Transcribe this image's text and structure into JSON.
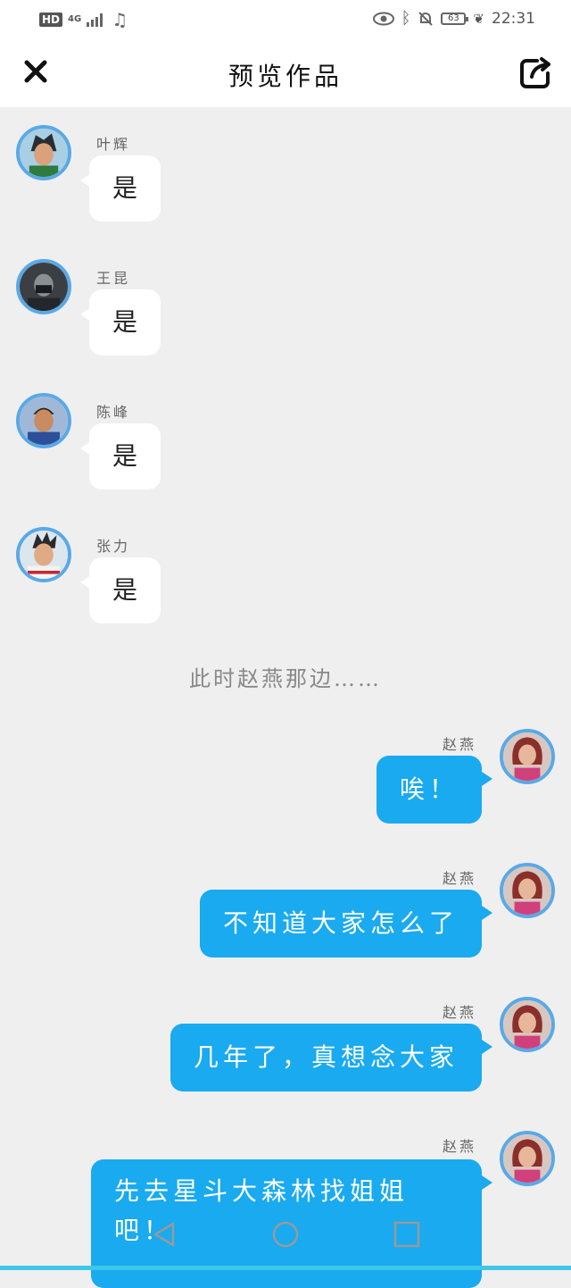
{
  "status_bar": {
    "hd": "HD",
    "network": "4G",
    "battery": "63",
    "time": "22:31"
  },
  "header": {
    "title": "预览作品",
    "close_icon": "close-icon",
    "share_icon": "share-icon"
  },
  "messages": [
    {
      "sender": "叶辉",
      "text": "是",
      "side": "left"
    },
    {
      "sender": "王昆",
      "text": "是",
      "side": "left"
    },
    {
      "sender": "陈峰",
      "text": "是",
      "side": "left"
    },
    {
      "sender": "张力",
      "text": "是",
      "side": "left"
    },
    {
      "narration": "此时赵燕那边……"
    },
    {
      "sender": "赵燕",
      "text": "唉！",
      "side": "right"
    },
    {
      "sender": "赵燕",
      "text": "不知道大家怎么了",
      "side": "right"
    },
    {
      "sender": "赵燕",
      "text": "几年了，真想念大家",
      "side": "right"
    },
    {
      "sender": "赵燕",
      "text_line1": "先去星斗大森林找姐姐",
      "text_line2": "吧！",
      "side": "right"
    }
  ],
  "colors": {
    "bubble_right": "#19aaf0",
    "avatar_ring": "#5aa9e6",
    "background": "#efeff0"
  },
  "nav": [
    "back-icon",
    "home-icon",
    "recents-icon"
  ]
}
